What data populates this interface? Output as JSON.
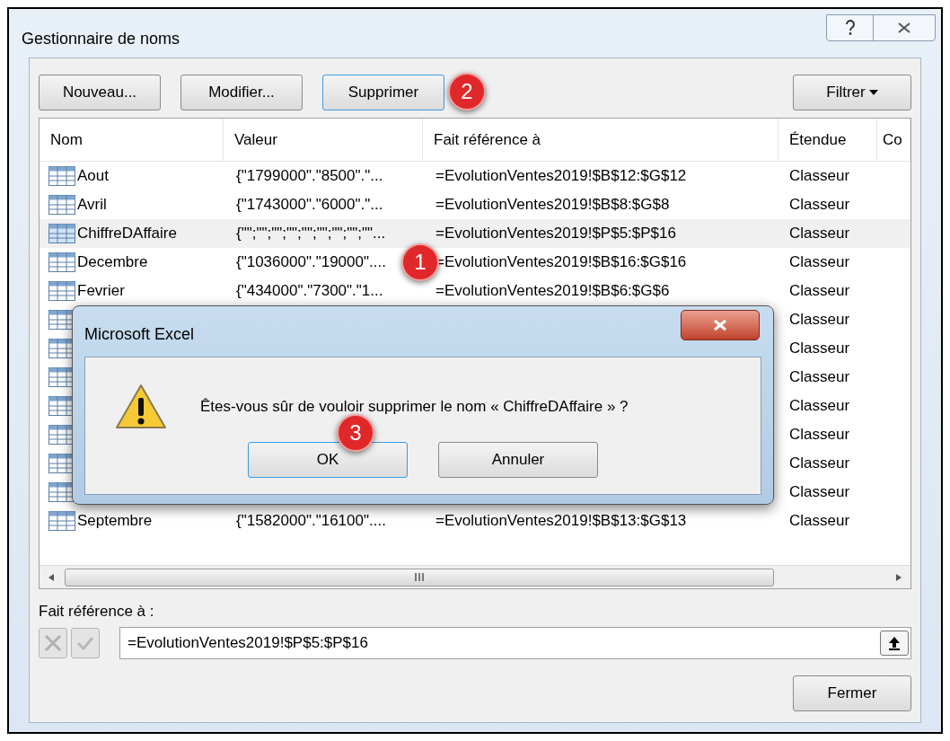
{
  "window": {
    "title": "Gestionnaire de noms"
  },
  "toolbar": {
    "buttons": [
      {
        "label": "Nouveau...",
        "kind": "button",
        "focused": false
      },
      {
        "label": "Modifier...",
        "kind": "button",
        "focused": false
      },
      {
        "label": "Supprimer",
        "kind": "button",
        "focused": true
      },
      {
        "label": "Filtrer",
        "kind": "dropdown",
        "focused": false
      }
    ]
  },
  "table": {
    "columns": [
      "Nom",
      "Valeur",
      "Fait référence à",
      "Étendue",
      "Co"
    ],
    "rows": [
      {
        "name": "Aout",
        "value": "{\"1799000\".\"8500\".\"...",
        "refers_to": "=EvolutionVentes2019!$B$12:$G$12",
        "scope": "Classeur",
        "selected": false
      },
      {
        "name": "Avril",
        "value": "{\"1743000\".\"6000\".\"...",
        "refers_to": "=EvolutionVentes2019!$B$8:$G$8",
        "scope": "Classeur",
        "selected": false
      },
      {
        "name": "ChiffreDAffaire",
        "value": "{\"\";\"\";\"\";\"\";\"\";\"\";\"\";\"\";\"\"...",
        "refers_to": "=EvolutionVentes2019!$P$5:$P$16",
        "scope": "Classeur",
        "selected": true
      },
      {
        "name": "Decembre",
        "value": "{\"1036000\".\"19000\"....",
        "refers_to": "=EvolutionVentes2019!$B$16:$G$16",
        "scope": "Classeur",
        "selected": false
      },
      {
        "name": "Fevrier",
        "value": "{\"434000\".\"7300\".\"1...",
        "refers_to": "=EvolutionVentes2019!$B$6:$G$6",
        "scope": "Classeur",
        "selected": false
      },
      {
        "scope": "Classeur",
        "selected": false
      },
      {
        "scope": "Classeur",
        "selected": false
      },
      {
        "scope": "Classeur",
        "selected": false
      },
      {
        "scope": "Classeur",
        "selected": false
      },
      {
        "scope": "Classeur",
        "selected": false
      },
      {
        "scope": "Classeur",
        "selected": false
      },
      {
        "scope": "Classeur",
        "selected": false
      },
      {
        "name": "Septembre",
        "value": "{\"1582000\".\"16100\"....",
        "refers_to": "=EvolutionVentes2019!$B$13:$G$13",
        "scope": "Classeur",
        "selected": false
      }
    ]
  },
  "refers_to": {
    "label": "Fait référence à :",
    "value": "=EvolutionVentes2019!$P$5:$P$16"
  },
  "close_button": "Fermer",
  "alert": {
    "title": "Microsoft Excel",
    "message": "Êtes-vous sûr de vouloir supprimer le nom « ChiffreDAffaire » ?",
    "buttons": [
      {
        "label": "OK",
        "focused": true
      },
      {
        "label": "Annuler",
        "focused": false
      }
    ]
  },
  "annotations": [
    {
      "text": "1"
    },
    {
      "text": "2"
    },
    {
      "text": "3"
    }
  ]
}
